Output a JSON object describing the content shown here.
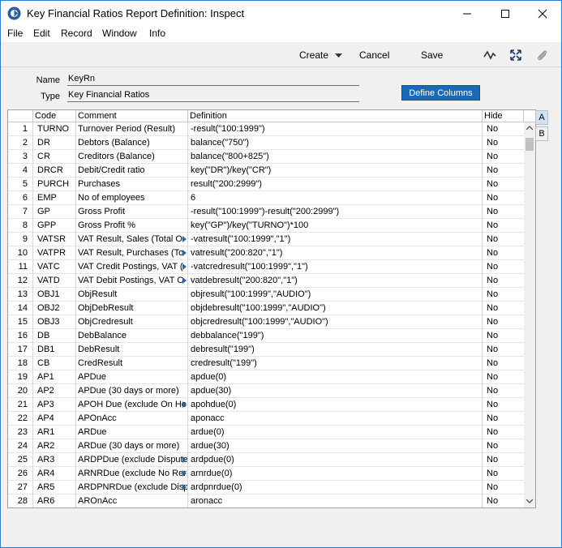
{
  "window": {
    "title": "Key Financial Ratios Report Definition: Inspect"
  },
  "menu": [
    "File",
    "Edit",
    "Record",
    "Window",
    "Info"
  ],
  "toolbar": {
    "create": "Create",
    "cancel": "Cancel",
    "save": "Save"
  },
  "form": {
    "name_label": "Name",
    "name_value": "KeyRn",
    "type_label": "Type",
    "type_value": "Key Financial Ratios",
    "define_columns": "Define Columns"
  },
  "grid": {
    "headers": {
      "code": "Code",
      "comment": "Comment",
      "definition": "Definition",
      "hide": "Hide"
    },
    "rows": [
      {
        "n": "1",
        "code": "TURNO",
        "comment": "Turnover Period (Result)",
        "def": "-result(\"100:1999\")",
        "hide": "No",
        "more": false
      },
      {
        "n": "2",
        "code": "DR",
        "comment": "Debtors (Balance)",
        "def": "balance(\"750\")",
        "hide": "No",
        "more": false
      },
      {
        "n": "3",
        "code": "CR",
        "comment": "Creditors (Balance)",
        "def": "balance(\"800+825\")",
        "hide": "No",
        "more": false
      },
      {
        "n": "4",
        "code": "DRCR",
        "comment": "Debit/Credit ratio",
        "def": "key(\"DR\")/key(\"CR\")",
        "hide": "No",
        "more": false
      },
      {
        "n": "5",
        "code": "PURCH",
        "comment": "Purchases",
        "def": "result(\"200:2999\")",
        "hide": "No",
        "more": false
      },
      {
        "n": "6",
        "code": "EMP",
        "comment": "No of employees",
        "def": "6",
        "hide": "No",
        "more": false
      },
      {
        "n": "7",
        "code": "GP",
        "comment": "Gross Profit",
        "def": "-result(\"100:1999\")-result(\"200:2999\")",
        "hide": "No",
        "more": false
      },
      {
        "n": "8",
        "code": "GPP",
        "comment": "Gross Profit %",
        "def": "key(\"GP\")/key(\"TURNO\")*100",
        "hide": "No",
        "more": false
      },
      {
        "n": "9",
        "code": "VATSR",
        "comment": "VAT Result, Sales (Total O",
        "def": "-vatresult(\"100:1999\",\"1\")",
        "hide": "No",
        "more": true
      },
      {
        "n": "10",
        "code": "VATPR",
        "comment": "VAT Result, Purchases (To",
        "def": "vatresult(\"200:820\",\"1\")",
        "hide": "No",
        "more": true
      },
      {
        "n": "11",
        "code": "VATC",
        "comment": "VAT Credit Postings, VAT (",
        "def": "-vatcredresult(\"100:1999\",\"1\")",
        "hide": "No",
        "more": true
      },
      {
        "n": "12",
        "code": "VATD",
        "comment": "VAT Debit Postings, VAT C",
        "def": "vatdebresult(\"200:820\",\"1\")",
        "hide": "No",
        "more": true
      },
      {
        "n": "13",
        "code": "OBJ1",
        "comment": "ObjResult",
        "def": "objresult(\"100:1999\",\"AUDIO\")",
        "hide": "No",
        "more": false
      },
      {
        "n": "14",
        "code": "OBJ2",
        "comment": "ObjDebResult",
        "def": "objdebresult(\"100:1999\",\"AUDIO\")",
        "hide": "No",
        "more": false
      },
      {
        "n": "15",
        "code": "OBJ3",
        "comment": "ObjCredresult",
        "def": "objcredresult(\"100:1999\",\"AUDIO\")",
        "hide": "No",
        "more": false
      },
      {
        "n": "16",
        "code": "DB",
        "comment": "DebBalance",
        "def": "debbalance(\"199\")",
        "hide": "No",
        "more": false
      },
      {
        "n": "17",
        "code": "DB1",
        "comment": "DebResult",
        "def": "debresult(\"199\")",
        "hide": "No",
        "more": false
      },
      {
        "n": "18",
        "code": "CB",
        "comment": "CredResult",
        "def": "credresult(\"199\")",
        "hide": "No",
        "more": false
      },
      {
        "n": "19",
        "code": "AP1",
        "comment": "APDue",
        "def": "apdue(0)",
        "hide": "No",
        "more": false
      },
      {
        "n": "20",
        "code": "AP2",
        "comment": "APDue (30 days or more)",
        "def": "apdue(30)",
        "hide": "No",
        "more": false
      },
      {
        "n": "21",
        "code": "AP3",
        "comment": "APOH Due (exclude On Ho",
        "def": "apohdue(0)",
        "hide": "No",
        "more": true
      },
      {
        "n": "22",
        "code": "AP4",
        "comment": "APOnAcc",
        "def": "aponacc",
        "hide": "No",
        "more": false
      },
      {
        "n": "23",
        "code": "AR1",
        "comment": "ARDue",
        "def": "ardue(0)",
        "hide": "No",
        "more": false
      },
      {
        "n": "24",
        "code": "AR2",
        "comment": "ARDue (30 days or more)",
        "def": "ardue(30)",
        "hide": "No",
        "more": false
      },
      {
        "n": "25",
        "code": "AR3",
        "comment": "ARDPDue (exclude Dispute",
        "def": "ardpdue(0)",
        "hide": "No",
        "more": true
      },
      {
        "n": "26",
        "code": "AR4",
        "comment": "ARNRDue (exclude No Rer",
        "def": "arnrdue(0)",
        "hide": "No",
        "more": true
      },
      {
        "n": "27",
        "code": "AR5",
        "comment": "ARDPNRDue (exclude Disp",
        "def": "ardpnrdue(0)",
        "hide": "No",
        "more": true
      },
      {
        "n": "28",
        "code": "AR6",
        "comment": "AROnAcc",
        "def": "aronacc",
        "hide": "No",
        "more": false
      }
    ]
  },
  "side_tabs": [
    "A",
    "B"
  ],
  "colors": {
    "accent": "#1a69b5",
    "titlebar_border": "#1e7fd6"
  }
}
